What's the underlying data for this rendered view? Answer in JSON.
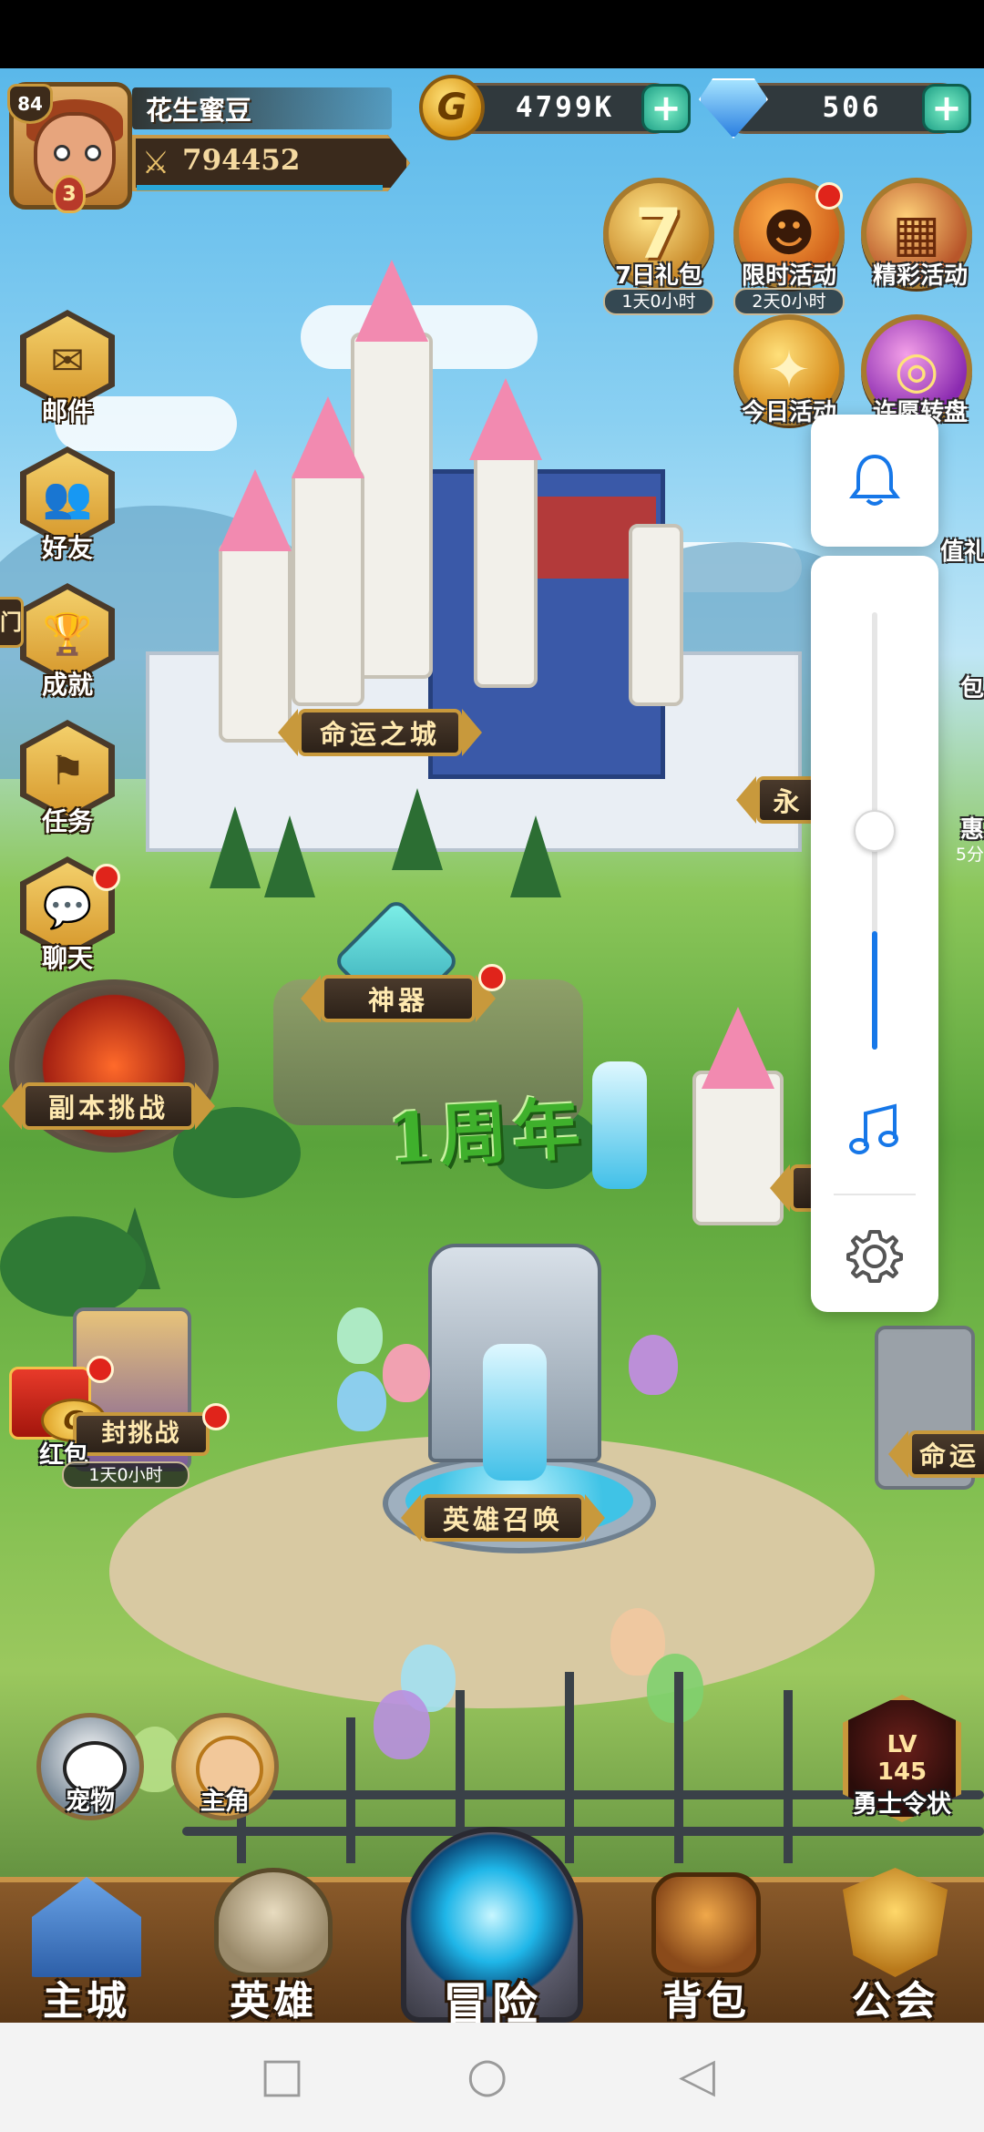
{
  "player": {
    "level": "84",
    "rank": "3",
    "name": "花生蜜豆",
    "power": "794452"
  },
  "resources": {
    "gold": {
      "icon": "G",
      "value": "4799K"
    },
    "gems": {
      "value": "506"
    }
  },
  "events": [
    {
      "label": "7日礼包",
      "glyph": "7",
      "timer": "1天0小时",
      "has_dot": false
    },
    {
      "label": "限时活动",
      "glyph": "☻",
      "timer": "2天0小时",
      "has_dot": true
    },
    {
      "label": "精彩活动",
      "glyph": "▦",
      "timer": "",
      "has_dot": false
    },
    {
      "label": "今日活动",
      "glyph": "✦",
      "timer": "",
      "has_dot": false
    },
    {
      "label": "许愿转盘",
      "glyph": "◎",
      "timer": "",
      "has_dot": false
    }
  ],
  "partial_labels": {
    "right_gift": "值礼包",
    "right_bag": "包",
    "right_sale": "惠",
    "right_sale_timer": "5分",
    "left_gate": "门",
    "right_banner": "永",
    "right_fate": "命运"
  },
  "side_menu": [
    {
      "label": "邮件",
      "glyph": "✉",
      "has_dot": false
    },
    {
      "label": "好友",
      "glyph": "👥",
      "has_dot": false
    },
    {
      "label": "成就",
      "glyph": "🏆",
      "has_dot": false
    },
    {
      "label": "任务",
      "glyph": "⚑",
      "has_dot": false
    },
    {
      "label": "聊天",
      "glyph": "💬",
      "has_dot": true
    }
  ],
  "locations": {
    "castle": "命运之城",
    "relic": "神器",
    "dungeon": "副本挑战",
    "summon": "英雄召唤",
    "anniversary": "1周年"
  },
  "challenge": {
    "label": "封挑战",
    "timer": "1天0小时",
    "red_packet": "红包"
  },
  "quick_buttons": {
    "pet": "宠物",
    "hero": "主角",
    "warrior_level": "LV",
    "warrior_value": "145",
    "warrior_label": "勇士令状"
  },
  "bottom_nav": [
    {
      "label": "主城"
    },
    {
      "label": "英雄"
    },
    {
      "label": "冒险"
    },
    {
      "label": "背包"
    },
    {
      "label": "公会"
    }
  ],
  "volume_panel": {
    "volume_level": 0.27,
    "bell_icon": "bell-icon",
    "music_icon": "music-note-icon",
    "settings_icon": "gear-icon",
    "accent_color": "#1677e8"
  },
  "system_nav": {
    "recent": "□",
    "home": "○",
    "back": "◁"
  }
}
